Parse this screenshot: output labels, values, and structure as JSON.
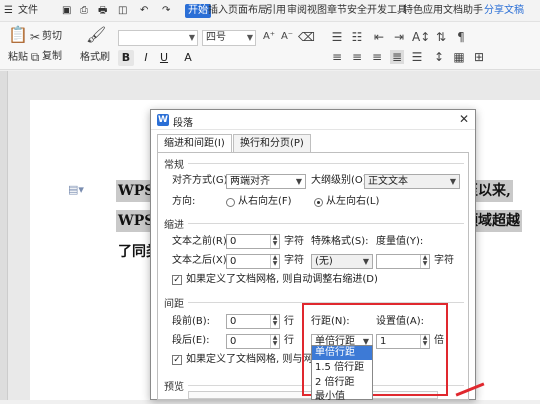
{
  "app": {
    "file_menu": "文件",
    "ribbon_tabs": [
      "开始",
      "插入",
      "页面布局",
      "引用",
      "审阅",
      "视图",
      "章节",
      "安全",
      "开发工具",
      "特色应用",
      "文档助手"
    ],
    "active_tab": "开始",
    "share": "分享文稿"
  },
  "ribbon": {
    "paste": "粘贴",
    "cut": "剪切",
    "copy": "复制",
    "format_painter": "格式刷",
    "font_size": "四号",
    "bold": "B",
    "italic": "I",
    "underline": "U",
    "strikethrough": "A"
  },
  "document": {
    "lines": [
      "WPS 是",
      "WPS O",
      "了同类"
    ],
    "right_lines": [
      "至以来,",
      "领域超越"
    ]
  },
  "dialog": {
    "title": "段落",
    "tabs": [
      "缩进和间距(I)",
      "换行和分页(P)"
    ],
    "sections": {
      "general": "常规",
      "indent": "缩进",
      "spacing": "间距",
      "preview": "预览"
    },
    "alignment_label": "对齐方式(G):",
    "alignment_value": "两端对齐",
    "outline_label": "大纲级别(O):",
    "outline_value": "正文文本",
    "direction_label": "方向:",
    "direction_rtl": "从右向左(F)",
    "direction_ltr": "从左向右(L)",
    "before_text_label": "文本之前(R):",
    "before_text_value": "0",
    "before_text_unit": "字符",
    "special_label": "特殊格式(S):",
    "special_value": "(无)",
    "measure_label": "度量值(Y):",
    "measure_value": "",
    "measure_unit": "字符",
    "after_text_label": "文本之后(X):",
    "after_text_value": "0",
    "after_text_unit": "字符",
    "grid_indent_check": "如果定义了文档网格, 则自动调整右缩进(D)",
    "before_label": "段前(B):",
    "before_value": "0",
    "before_unit": "行",
    "after_label": "段后(E):",
    "after_value": "0",
    "after_unit": "行",
    "line_spacing_label": "行距(N):",
    "line_spacing_value": "单倍行距",
    "set_value_label": "设置值(A):",
    "set_value": "1",
    "set_value_unit": "倍",
    "grid_align_check": "如果定义了文档网格, 则与网格对",
    "line_spacing_options": [
      "单倍行距",
      "1.5 倍行距",
      "2 倍行距",
      "最小值"
    ]
  },
  "colors": {
    "accent": "#2b6fd6",
    "highlight_box": "#e0282e"
  }
}
